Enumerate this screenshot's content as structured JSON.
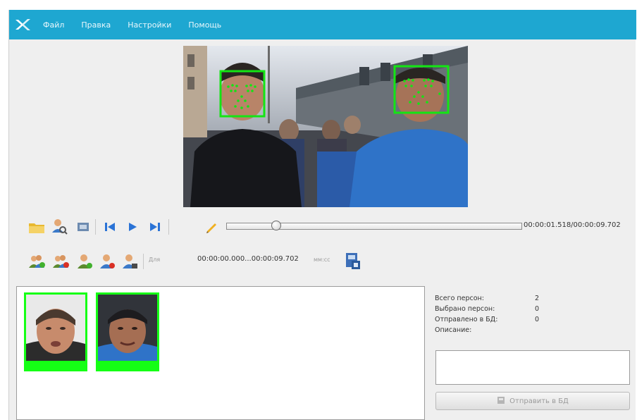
{
  "menu": {
    "items": [
      {
        "label": "Файл"
      },
      {
        "label": "Правка"
      },
      {
        "label": "Настройки"
      },
      {
        "label": "Помощь"
      }
    ]
  },
  "colors": {
    "menubar": "#1ea7d1",
    "face_box": "#14e514",
    "thumb_frame": "#15ff15"
  },
  "player": {
    "time": "00:00:01.518/00:00:09.702",
    "progress": 0.156
  },
  "range": {
    "from_label": "Для",
    "value": "00:00:00.000...00:00:09.702",
    "to_label": "мм:сс"
  },
  "icons": {
    "row1": [
      "open-folder-icon",
      "search-person-icon",
      "frame-icon",
      "skip-back-icon",
      "play-icon",
      "skip-forward-icon",
      "pencil-icon"
    ],
    "row2": [
      "add-group-icon",
      "remove-group-icon",
      "add-person-icon",
      "remove-person-icon",
      "edit-person-icon",
      "save-database-icon"
    ]
  },
  "stats": {
    "total_label": "Всего персон:",
    "total_value": "2",
    "selected_label": "Выбрано персон:",
    "selected_value": "0",
    "sent_label": "Отправлено в БД:",
    "sent_value": "0",
    "description_label": "Описание:"
  },
  "send_button": {
    "label": "Отправить в БД"
  }
}
